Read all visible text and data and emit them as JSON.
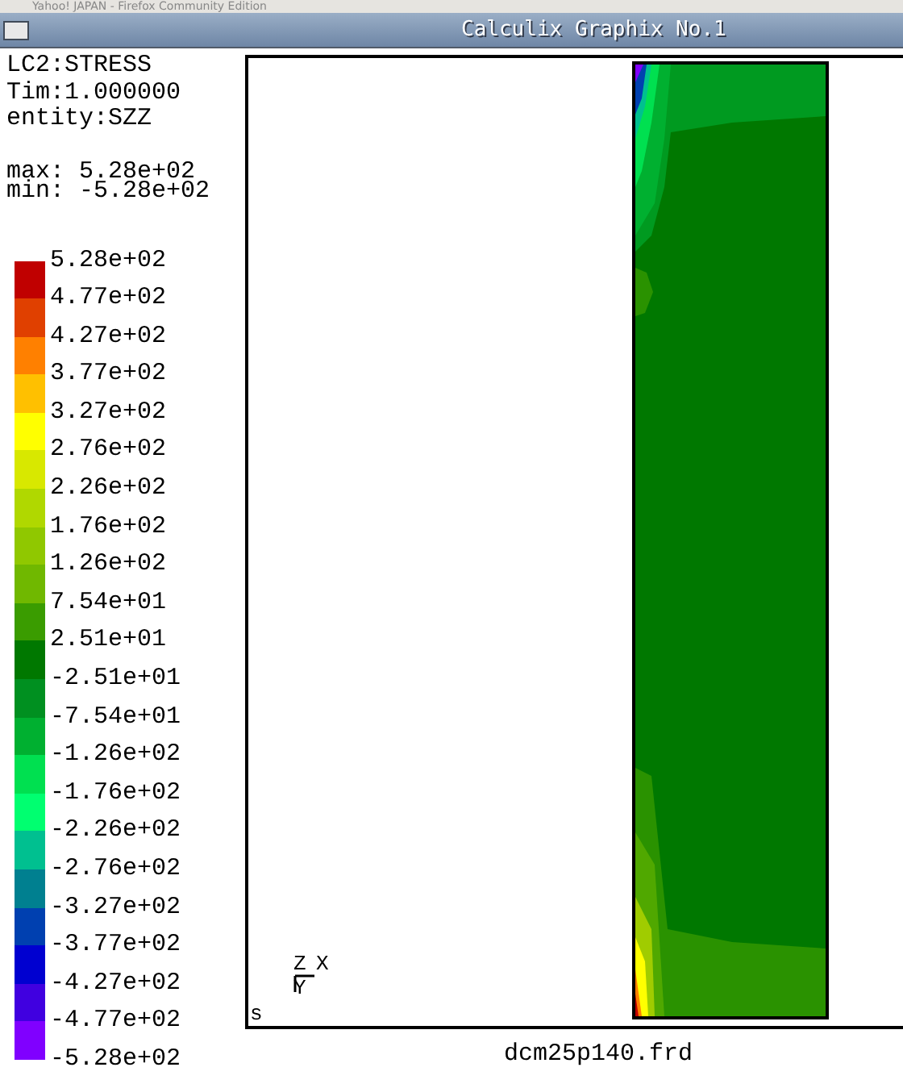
{
  "background_window": {
    "title": "Yahoo! JAPAN - Firefox Community Edition"
  },
  "window": {
    "title": "Calculix Graphix No.1"
  },
  "info": {
    "lines": [
      "LC2:STRESS",
      "Tim:1.000000",
      "entity:SZZ"
    ],
    "max": "max: 5.28e+02",
    "min": "min: -5.28e+02"
  },
  "legend": {
    "labels": [
      "5.28e+02",
      "4.77e+02",
      "4.27e+02",
      "3.77e+02",
      "3.27e+02",
      "2.76e+02",
      "2.26e+02",
      "1.76e+02",
      "1.26e+02",
      "7.54e+01",
      "2.51e+01",
      "-2.51e+01",
      "-7.54e+01",
      "-1.26e+02",
      "-1.76e+02",
      "-2.26e+02",
      "-2.76e+02",
      "-3.27e+02",
      "-3.77e+02",
      "-4.27e+02",
      "-4.77e+02",
      "-5.28e+02"
    ],
    "swatches": [
      {
        "color": "#c00000"
      },
      {
        "color": "#e04000"
      },
      {
        "color": "#ff8000"
      },
      {
        "color": "#ffc000"
      },
      {
        "color": "#ffff00"
      },
      {
        "color": "#d8e800"
      },
      {
        "color": "#b0d800"
      },
      {
        "color": "#90c800"
      },
      {
        "color": "#70b800"
      },
      {
        "color": "#3a9c00"
      },
      {
        "color": "#007800"
      },
      {
        "color": "#009020"
      },
      {
        "color": "#00b030"
      },
      {
        "color": "#00e050"
      },
      {
        "color": "#00ff70"
      },
      {
        "color": "#00c090"
      },
      {
        "color": "#008090"
      },
      {
        "color": "#0040b0"
      },
      {
        "color": "#0000d0"
      },
      {
        "color": "#4000e0"
      },
      {
        "color": "#8000ff"
      }
    ]
  },
  "viewport": {
    "corner_label": "s",
    "axes": {
      "z": "Z",
      "x": "X",
      "y": "Y"
    }
  },
  "file_name": "dcm25p140.frd"
}
